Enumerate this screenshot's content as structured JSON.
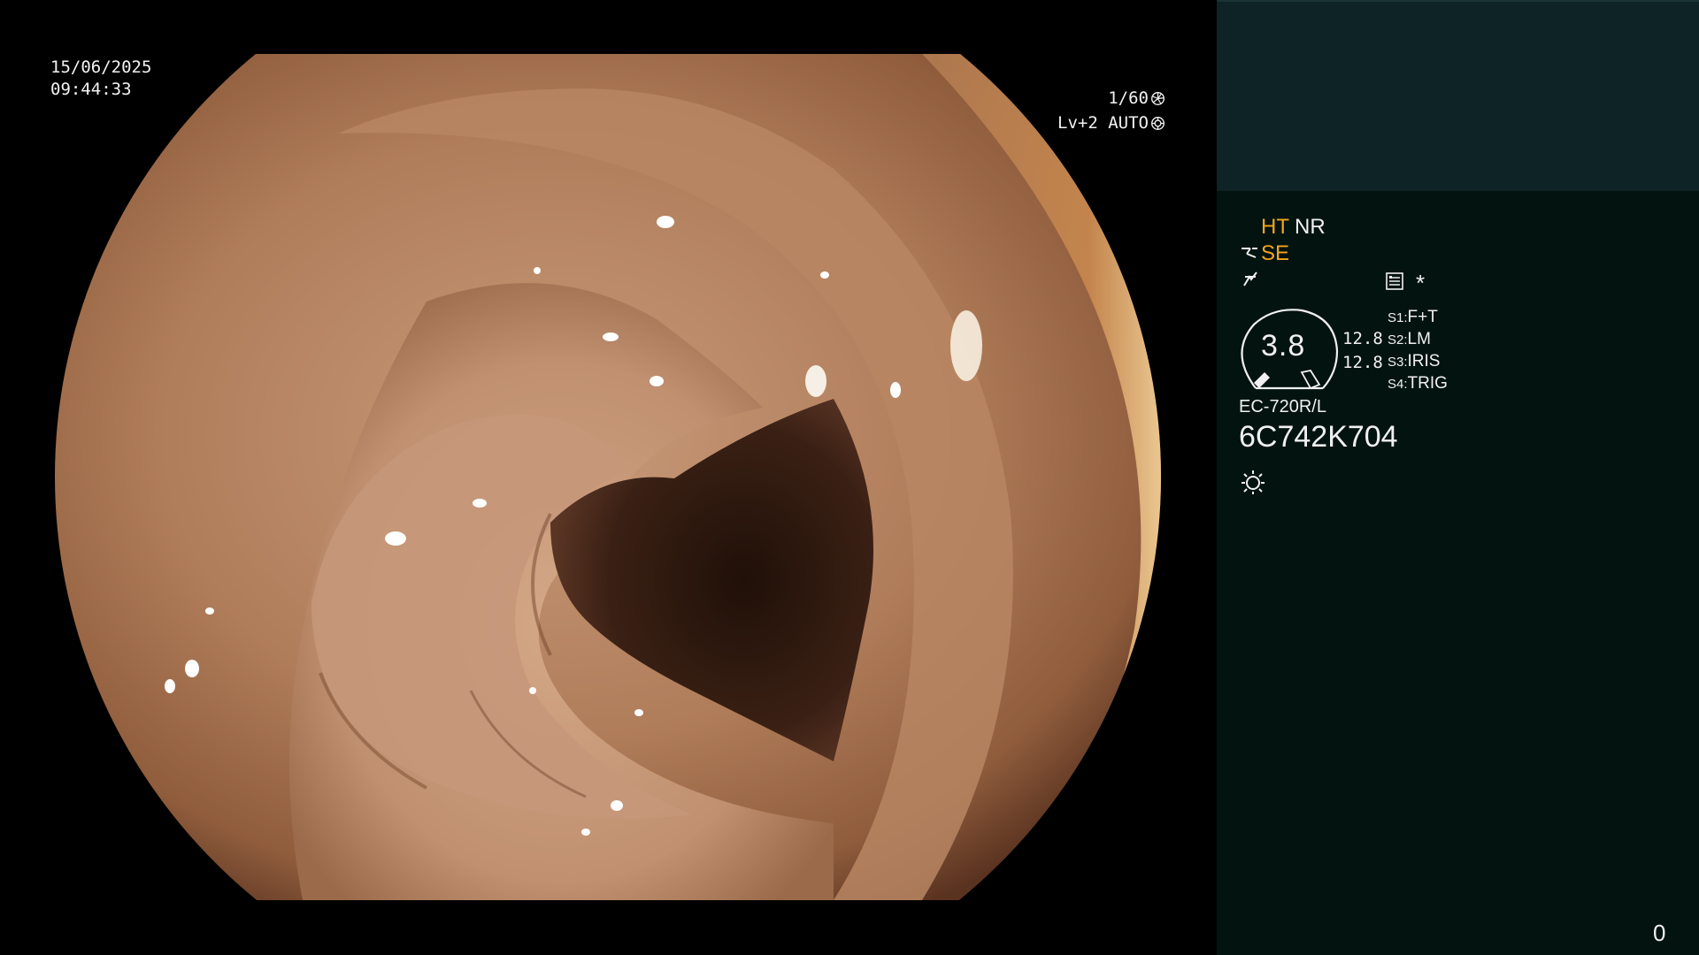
{
  "overlay": {
    "date": "15/06/2025",
    "time": "09:44:33",
    "shutter": "1/60",
    "iris_mode": "Lv+2 AUTO"
  },
  "panel": {
    "ht": "HT",
    "nr": "NR",
    "se": "SE",
    "star": "*",
    "dial_value": "3.8",
    "value_1": "12.8",
    "value_2": "12.8",
    "slots": [
      {
        "key": "S1:",
        "value": "F+T"
      },
      {
        "key": "S2:",
        "value": "LM"
      },
      {
        "key": "S3:",
        "value": "IRIS"
      },
      {
        "key": "S4:",
        "value": "TRIG"
      }
    ],
    "model": "EC-720R/L",
    "serial": "6C742K704",
    "counter": "0"
  },
  "icons": {
    "shutter": "aperture-icon",
    "iris": "iris-icon",
    "se": "scope-tip-icon",
    "enhance": "structure-enhance-icon",
    "list": "menu-list-icon",
    "light": "light-source-icon"
  },
  "colors": {
    "amber": "#f2a51c",
    "panel_top": "#0e2325",
    "panel_bg": "#031310"
  }
}
